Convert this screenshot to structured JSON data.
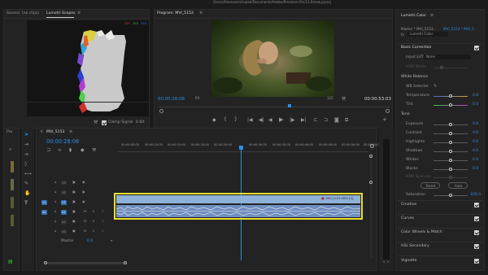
{
  "title_bar": "/Users/thomasmichulah/Documents/Adobe/Premiere Pro/13.0/new.prproj",
  "scopes": {
    "source_tab": "Source: (no clips)",
    "lumetri_tab": "Lumetri Scopes",
    "menu_icon": "≡",
    "scale_labels": [
      "255",
      "255",
      "255"
    ],
    "clamp_label": "Clamp Signal",
    "bit_depth": "8 Bit"
  },
  "program": {
    "tab": "Program: MVI_5153",
    "menu_icon": "≡",
    "timecode": "00:00:28:08",
    "fit": "Fit",
    "fraction": "1/2",
    "duration": "00:00:53:03",
    "transport": [
      "◆",
      "{",
      "}",
      "|◀",
      "◀|",
      "◀",
      "▶",
      "|▶",
      "▶|",
      "⊏",
      "⊐",
      "◙",
      "⧉",
      "+"
    ]
  },
  "timeline": {
    "tab": "MVI_5153",
    "menu_icon": "≡",
    "timecode": "00:00:28:08",
    "ruler": [
      "00:00:05:00",
      "00:00:10:00",
      "00:00:15:00",
      "00:00:20:00",
      "00:00:25:00",
      "00:00:30:00",
      "00:00:35:00",
      "00:00:40:00",
      "00:00:45:00",
      "00:00:50:00",
      "00:00:55:00"
    ],
    "video_tracks": [
      "V3",
      "V2",
      "V1"
    ],
    "audio_tracks": [
      "A1",
      "A2",
      "A3"
    ],
    "track_buttons": [
      "M",
      "S"
    ],
    "master_label": "Master",
    "master_value": "0.0",
    "clip_name": "MVI_5153.MOV [V]",
    "meter_labels": [
      "S",
      "S"
    ]
  },
  "project_panel": {
    "tab": "Pro"
  },
  "lumetri": {
    "tab": "Lumetri Color",
    "menu_icon": "≡",
    "master_label": "Master * MVI_5153...",
    "clip_label": "MVI_5153 * MVI_5...",
    "effect_label": "Lumetri Color",
    "basic": {
      "title": "Basic Correction",
      "input_lut_label": "Input LUT",
      "input_lut_value": "None",
      "hdr_white": "HDR White",
      "wb_title": "White Balance",
      "wb_selector": "WB Selector",
      "temperature": {
        "label": "Temperature",
        "value": "0.0"
      },
      "tint": {
        "label": "Tint",
        "value": "0.0"
      },
      "tone_title": "Tone",
      "tone": [
        {
          "label": "Exposure",
          "value": "0.0"
        },
        {
          "label": "Contrast",
          "value": "0.0"
        },
        {
          "label": "Highlights",
          "value": "0.0"
        },
        {
          "label": "Shadows",
          "value": "0.0"
        },
        {
          "label": "Whites",
          "value": "0.0"
        },
        {
          "label": "Blacks",
          "value": "0.0"
        }
      ],
      "hdr_specular": "HDR Specular",
      "reset": "Reset",
      "auto": "Auto",
      "saturation": {
        "label": "Saturation",
        "value": "100.0"
      }
    },
    "sections": [
      "Creative",
      "Curves",
      "Color Wheels & Match",
      "HSL Secondary",
      "Vignette"
    ]
  },
  "colors": {
    "accent": "#2e8ee6",
    "clip_border": "#e8df2b",
    "clip_fill": "#8fb0d8",
    "audio_fill": "#6d8ec0"
  }
}
